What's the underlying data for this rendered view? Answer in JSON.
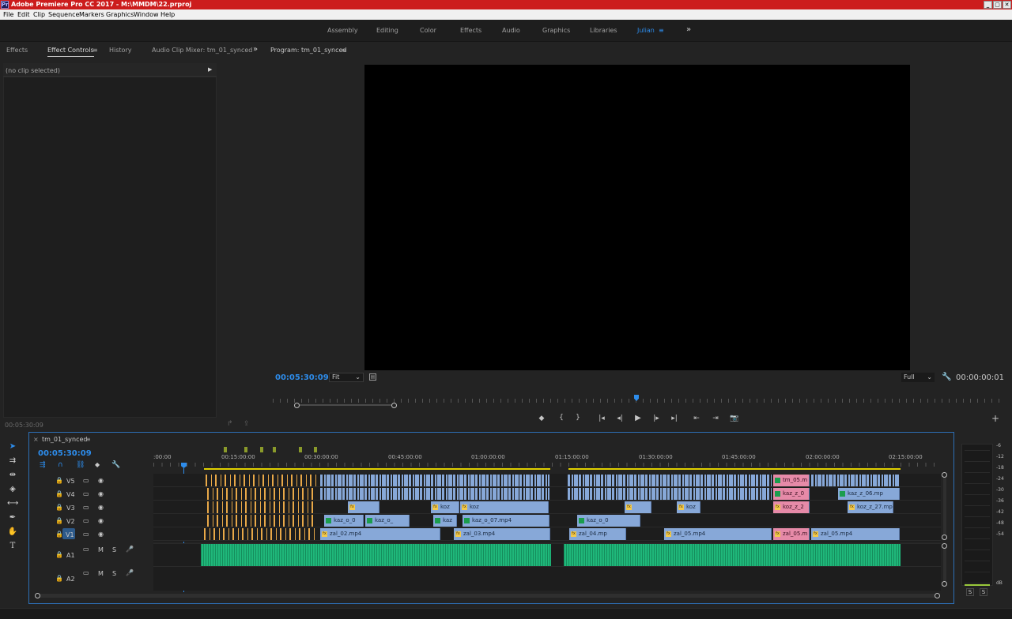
{
  "window": {
    "title": "Adobe Premiere Pro CC 2017 - M:\\MMDM\\22.prproj",
    "app_icon": "Pr",
    "controls": [
      "_",
      "▢",
      "✕"
    ]
  },
  "menu": [
    "File",
    "Edit",
    "Clip",
    "Sequence",
    "Markers",
    "Graphics",
    "Window",
    "Help"
  ],
  "workspaces": {
    "items": [
      "Assembly",
      "Editing",
      "Color",
      "Effects",
      "Audio",
      "Graphics",
      "Libraries",
      "Julian"
    ],
    "active": "Julian",
    "more": "»"
  },
  "left_panel": {
    "tabs": [
      "Effects",
      "Effect Controls",
      "History",
      "Audio Clip Mixer: tm_01_synced"
    ],
    "active_tab": "Effect Controls",
    "more": "»",
    "no_clip": "(no clip selected)",
    "footer_timecode": "00:05:30:09"
  },
  "program_monitor": {
    "title": "Program: tm_01_synced",
    "timecode": "00:05:30:09",
    "zoom": "Fit",
    "resolution": "Full",
    "duration": "00:00:00:01",
    "transport": [
      "◆",
      "{",
      "}",
      "|◂",
      "◂|",
      "▶",
      "|▸",
      "▸|",
      "⇤",
      "⇥",
      "📷"
    ],
    "add": "+"
  },
  "timeline": {
    "sequence": "tm_01_synced",
    "timecode": "00:05:30:09",
    "ruler": [
      ":00:00",
      "00:15:00:00",
      "00:30:00:00",
      "00:45:00:00",
      "01:00:00:00",
      "01:15:00:00",
      "01:30:00:00",
      "01:45:00:00",
      "02:00:00:00",
      "02:15:00:00"
    ],
    "video_tracks": [
      "V5",
      "V4",
      "V3",
      "V2",
      "V1"
    ],
    "audio_tracks": [
      "A1",
      "A2"
    ],
    "track_buttons": {
      "mute": "M",
      "solo": "S"
    },
    "clips": {
      "v5a": "tm_05.m",
      "v4a": "kaz_z_0",
      "v4b": "kaz_z_06.mp",
      "v3a": "koz",
      "v3b": "koz",
      "v3c": "koz_z_2",
      "v3d": "koz_z_27.mp",
      "v3e": "koz",
      "v2a": "kaz_o_0",
      "v2b": "kaz_o_",
      "v2c": "kaz",
      "v2d": "kaz_o_07.mp4",
      "v2e": "kaz_o_0",
      "v1a": "zal_02.mp4",
      "v1b": "zal_03.mp4",
      "v1c": "zal_04.mp",
      "v1d": "zal_05.mp4",
      "v1e": "zal_05.m",
      "v1f": "zal_05.mp4"
    }
  },
  "audio_meter": {
    "labels": [
      "-6",
      "-12",
      "-18",
      "-24",
      "-30",
      "-36",
      "-42",
      "-48",
      "-54",
      "dB"
    ],
    "solo": [
      "S",
      "S"
    ]
  },
  "colors": {
    "accent": "#2d8ceb",
    "clip_video": "#87a8d8",
    "clip_audio": "#1fb77a",
    "clip_pink": "#e68aa8"
  }
}
